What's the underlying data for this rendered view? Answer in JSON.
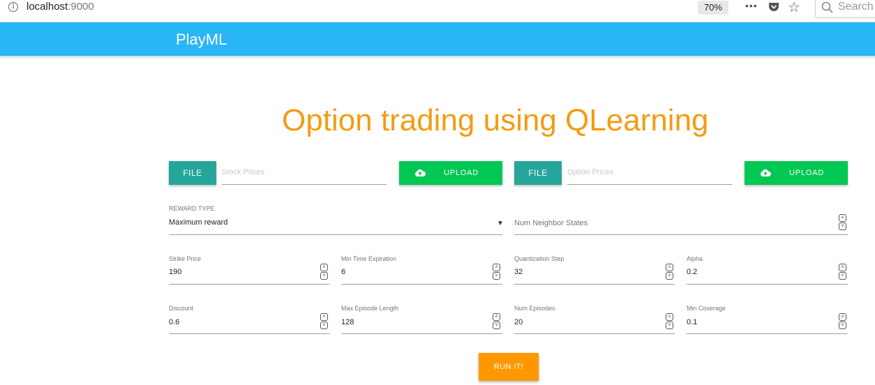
{
  "browser": {
    "url_host": "localhost",
    "url_port": ":9000",
    "zoom": "70%",
    "menu_dots": "•••",
    "search_placeholder": "Search"
  },
  "header": {
    "brand": "PlayML"
  },
  "main": {
    "title": "Option trading using QLearning",
    "uploads": [
      {
        "file_label": "FILE",
        "placeholder": "Stock Prices",
        "upload_label": "UPLOAD"
      },
      {
        "file_label": "FILE",
        "placeholder": "Option Prices",
        "upload_label": "UPLOAD"
      }
    ],
    "reward": {
      "label": "REWARD TYPE",
      "value": "Maximum reward"
    },
    "neighbor": {
      "placeholder": "Num Neighbor States"
    },
    "fields": [
      {
        "label": "Strike Price",
        "value": "190"
      },
      {
        "label": "Min Time Expiration",
        "value": "6"
      },
      {
        "label": "Quantization Step",
        "value": "32"
      },
      {
        "label": "Alpha",
        "value": "0.2"
      },
      {
        "label": "Discount",
        "value": "0.6"
      },
      {
        "label": "Max Episode Length",
        "value": "128"
      },
      {
        "label": "Num Episodes",
        "value": "20"
      },
      {
        "label": "Min Coverage",
        "value": "0.1"
      }
    ],
    "run_label": "RUN IT!"
  },
  "colors": {
    "appbar": "#29b6f6",
    "title": "#f39c12",
    "file_button": "#26a69a",
    "upload_button": "#00c853",
    "run_button": "#ff9800"
  }
}
